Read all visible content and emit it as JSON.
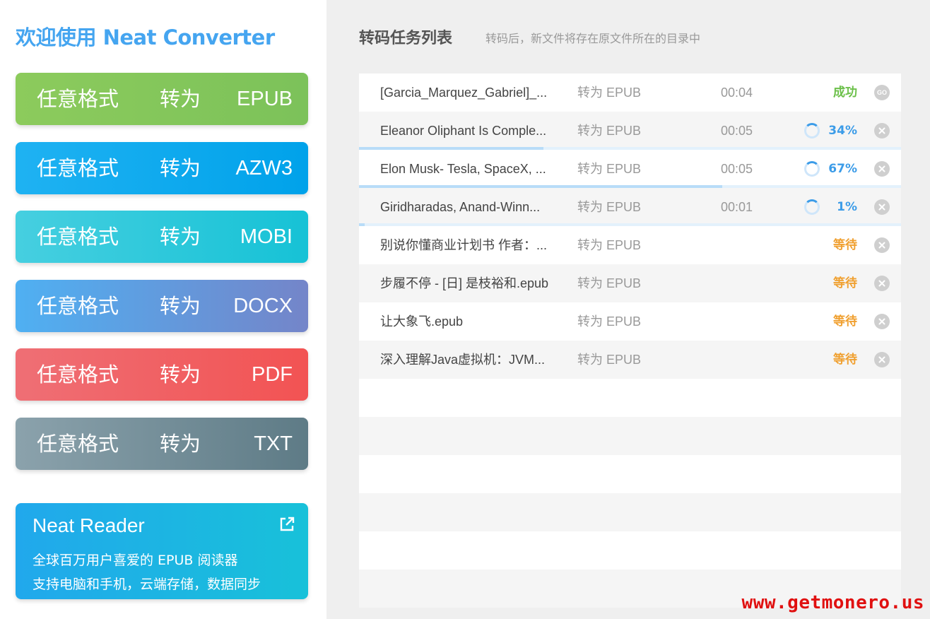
{
  "app": {
    "title": "欢迎使用 Neat Converter"
  },
  "buttons": [
    {
      "from": "任意格式",
      "verb": "转为",
      "format": "EPUB"
    },
    {
      "from": "任意格式",
      "verb": "转为",
      "format": "AZW3"
    },
    {
      "from": "任意格式",
      "verb": "转为",
      "format": "MOBI"
    },
    {
      "from": "任意格式",
      "verb": "转为",
      "format": "DOCX"
    },
    {
      "from": "任意格式",
      "verb": "转为",
      "format": "PDF"
    },
    {
      "from": "任意格式",
      "verb": "转为",
      "format": "TXT"
    }
  ],
  "promo": {
    "title": "Neat Reader",
    "line1": "全球百万用户喜爱的 EPUB 阅读器",
    "line2": "支持电脑和手机，云端存储，数据同步",
    "icon": "external-link-icon"
  },
  "tasks": {
    "title": "转码任务列表",
    "subtitle": "转码后，新文件将存在原文件所在的目录中",
    "rows": [
      {
        "name": "[Garcia_Marquez_Gabriel]_...",
        "target": "转为 EPUB",
        "time": "00:04",
        "status": "成功",
        "state": "success",
        "action": "GO"
      },
      {
        "name": "Eleanor Oliphant Is Comple...",
        "target": "转为 EPUB",
        "time": "00:05",
        "status": "34%",
        "state": "progress",
        "progress": 0.34
      },
      {
        "name": "Elon Musk- Tesla, SpaceX, ...",
        "target": "转为 EPUB",
        "time": "00:05",
        "status": "67%",
        "state": "progress",
        "progress": 0.67
      },
      {
        "name": "Giridharadas, Anand-Winn...",
        "target": "转为 EPUB",
        "time": "00:01",
        "status": "1%",
        "state": "progress",
        "progress": 0.01
      },
      {
        "name": "别说你懂商业计划书 作者：...",
        "target": "转为 EPUB",
        "time": "",
        "status": "等待",
        "state": "wait"
      },
      {
        "name": "步履不停 - [日] 是枝裕和.epub",
        "target": "转为 EPUB",
        "time": "",
        "status": "等待",
        "state": "wait"
      },
      {
        "name": "让大象飞.epub",
        "target": "转为 EPUB",
        "time": "",
        "status": "等待",
        "state": "wait"
      },
      {
        "name": "深入理解Java虚拟机：JVM...",
        "target": "转为 EPUB",
        "time": "",
        "status": "等待",
        "state": "wait"
      }
    ]
  },
  "watermark": "www.getmonero.us"
}
